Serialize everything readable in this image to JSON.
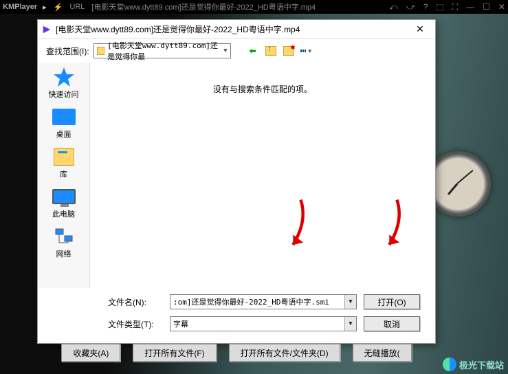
{
  "titlebar": {
    "app_name": "KMPlayer",
    "url_label": "URL",
    "title": "[电影天堂www.dytt89.com]还是觉得你最好-2022_HD粤语中字.mp4"
  },
  "dialog": {
    "title": "[电影天堂www.dytt89.com]还是觉得你最好-2022_HD粤语中字.mp4",
    "lookin_label": "查找范围(I):",
    "lookin_value": "[电影天堂www.dytt89.com]还是觉得你最",
    "empty_message": "没有与搜索条件匹配的项。",
    "places": {
      "quick": "快速访问",
      "desktop": "桌面",
      "libraries": "库",
      "thispc": "此电脑",
      "network": "网络"
    },
    "filename_label": "文件名(N):",
    "filename_value": ":om]还是觉得你最好-2022_HD粤语中字.smi",
    "filetype_label": "文件类型(T):",
    "filetype_value": "字幕",
    "open_button": "打开(O)",
    "cancel_button": "取消"
  },
  "bottombar": {
    "favorites": "收藏夹(A)",
    "open_all_files": "打开所有文件(F)",
    "open_all_folders": "打开所有文件/文件夹(D)",
    "seamless": "无缝播放("
  },
  "watermark": "极光下载站"
}
